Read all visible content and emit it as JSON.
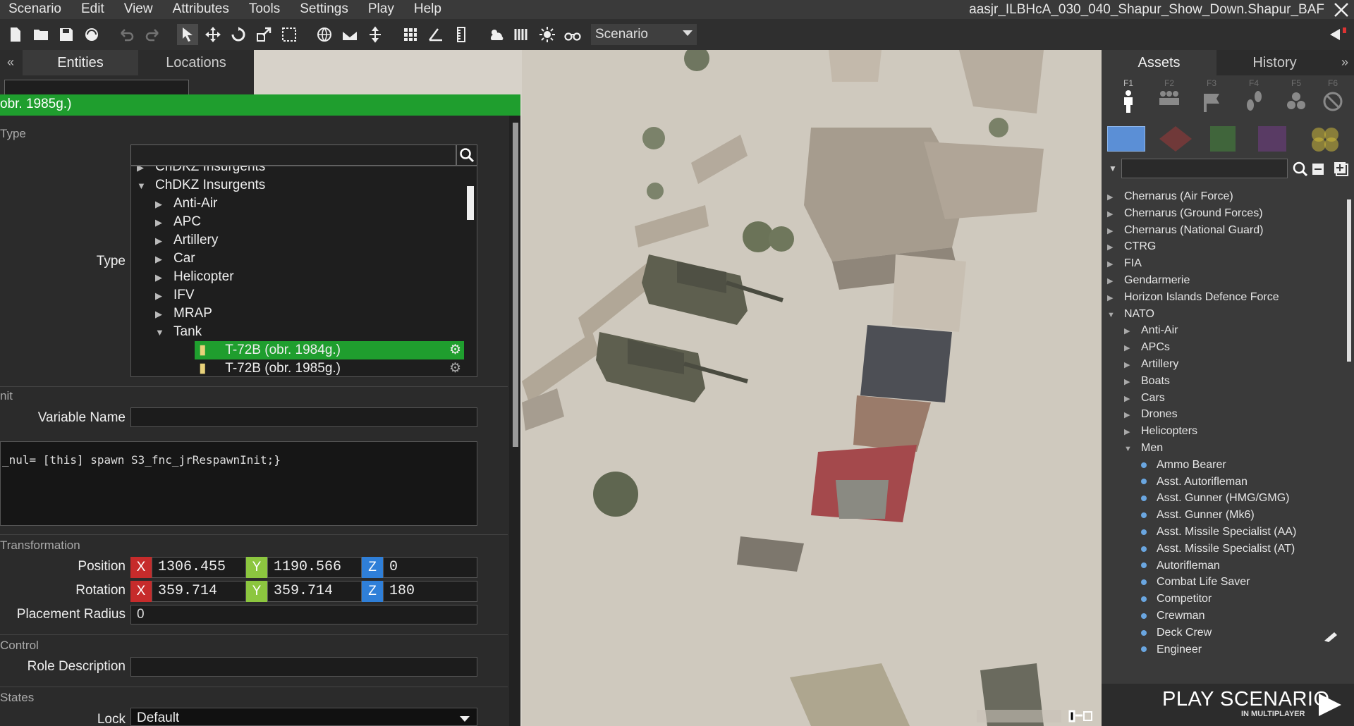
{
  "menubar": {
    "items": [
      "Scenario",
      "Edit",
      "View",
      "Attributes",
      "Tools",
      "Settings",
      "Play",
      "Help"
    ],
    "window_title": "aasjr_ILBHcA_030_040_Shapur_Show_Down.Shapur_BAF"
  },
  "toolbar": {
    "mode_value": "Scenario",
    "icons": [
      "new-file-icon",
      "open-folder-icon",
      "save-icon",
      "publish-icon",
      "undo-icon",
      "redo-icon",
      "select-icon",
      "move-icon",
      "rotate-icon",
      "scale-icon",
      "area-select-icon",
      "globe-icon",
      "surface-snap-icon",
      "vertical-mode-icon",
      "grid-icon",
      "angle-snap-icon",
      "ruler-icon",
      "weather-icon",
      "map-textures-icon",
      "lighting-icon",
      "binoculars-icon"
    ]
  },
  "left_panel": {
    "tabs": [
      "Entities",
      "Locations"
    ],
    "collapse_label": "«"
  },
  "attributes": {
    "title": "obr. 1985g.)",
    "sections": {
      "type": "Type",
      "init": "nit",
      "transformation": "Transformation",
      "control": "Control",
      "states": "States"
    },
    "type_label": "Type",
    "type_tree": [
      {
        "label": "ChDKZ Insurgents",
        "level": 0,
        "state": "partial"
      },
      {
        "label": "ChDKZ Insurgents",
        "level": 0,
        "state": "expanded"
      },
      {
        "label": "Anti-Air",
        "level": 1,
        "state": "collapsed"
      },
      {
        "label": "APC",
        "level": 1,
        "state": "collapsed"
      },
      {
        "label": "Artillery",
        "level": 1,
        "state": "collapsed"
      },
      {
        "label": "Car",
        "level": 1,
        "state": "collapsed"
      },
      {
        "label": "Helicopter",
        "level": 1,
        "state": "collapsed"
      },
      {
        "label": "IFV",
        "level": 1,
        "state": "collapsed"
      },
      {
        "label": "MRAP",
        "level": 1,
        "state": "collapsed"
      },
      {
        "label": "Tank",
        "level": 1,
        "state": "expanded"
      },
      {
        "label": "T-72B (obr. 1984g.)",
        "level": 2,
        "state": "selected"
      },
      {
        "label": "T-72B (obr. 1985g.)",
        "level": 2,
        "state": "leaf"
      }
    ],
    "variable_name_label": "Variable Name",
    "variable_name_value": "",
    "init_code": "_nul= [this] spawn S3_fnc_jrRespawnInit;}",
    "position_label": "Position",
    "position": {
      "x": "1306.455",
      "y": "1190.566",
      "z": "0"
    },
    "rotation_label": "Rotation",
    "rotation": {
      "x": "359.714",
      "y": "359.714",
      "z": "180"
    },
    "axis_labels": {
      "x": "X",
      "y": "Y",
      "z": "Z"
    },
    "placement_radius_label": "Placement Radius",
    "placement_radius_value": "0",
    "role_description_label": "Role Description",
    "role_description_value": "",
    "lock_label": "Lock",
    "lock_value": "Default"
  },
  "right_panel": {
    "tabs": [
      "Assets",
      "History"
    ],
    "expand_label": "»",
    "fkeys": [
      "F1",
      "F2",
      "F3",
      "F4",
      "F5",
      "F6"
    ],
    "side_colors": [
      "#5b8fd6",
      "#c23a3a",
      "#4aa83f",
      "#8a3fa6",
      "#d8c23a"
    ],
    "asset_tree": [
      {
        "label": "Chernarus (Air Force)",
        "level": 0,
        "state": "collapsed"
      },
      {
        "label": "Chernarus (Ground Forces)",
        "level": 0,
        "state": "collapsed"
      },
      {
        "label": "Chernarus (National Guard)",
        "level": 0,
        "state": "collapsed"
      },
      {
        "label": "CTRG",
        "level": 0,
        "state": "collapsed"
      },
      {
        "label": "FIA",
        "level": 0,
        "state": "collapsed"
      },
      {
        "label": "Gendarmerie",
        "level": 0,
        "state": "collapsed"
      },
      {
        "label": "Horizon Islands Defence Force",
        "level": 0,
        "state": "collapsed"
      },
      {
        "label": "NATO",
        "level": 0,
        "state": "expanded"
      },
      {
        "label": "Anti-Air",
        "level": 1,
        "state": "collapsed"
      },
      {
        "label": "APCs",
        "level": 1,
        "state": "collapsed"
      },
      {
        "label": "Artillery",
        "level": 1,
        "state": "collapsed"
      },
      {
        "label": "Boats",
        "level": 1,
        "state": "collapsed"
      },
      {
        "label": "Cars",
        "level": 1,
        "state": "collapsed"
      },
      {
        "label": "Drones",
        "level": 1,
        "state": "collapsed"
      },
      {
        "label": "Helicopters",
        "level": 1,
        "state": "collapsed"
      },
      {
        "label": "Men",
        "level": 1,
        "state": "expanded"
      },
      {
        "label": "Ammo Bearer",
        "level": 2,
        "state": "unit"
      },
      {
        "label": "Asst. Autorifleman",
        "level": 2,
        "state": "unit"
      },
      {
        "label": "Asst. Gunner (HMG/GMG)",
        "level": 2,
        "state": "unit"
      },
      {
        "label": "Asst. Gunner (Mk6)",
        "level": 2,
        "state": "unit"
      },
      {
        "label": "Asst. Missile Specialist (AA)",
        "level": 2,
        "state": "unit"
      },
      {
        "label": "Asst. Missile Specialist (AT)",
        "level": 2,
        "state": "unit"
      },
      {
        "label": "Autorifleman",
        "level": 2,
        "state": "unit"
      },
      {
        "label": "Combat Life Saver",
        "level": 2,
        "state": "unit"
      },
      {
        "label": "Competitor",
        "level": 2,
        "state": "unit"
      },
      {
        "label": "Crewman",
        "level": 2,
        "state": "unit"
      },
      {
        "label": "Deck Crew",
        "level": 2,
        "state": "unit"
      },
      {
        "label": "Engineer",
        "level": 2,
        "state": "unit"
      }
    ]
  },
  "play": {
    "label": "PLAY SCENARIO",
    "sub": "IN MULTIPLAYER"
  }
}
